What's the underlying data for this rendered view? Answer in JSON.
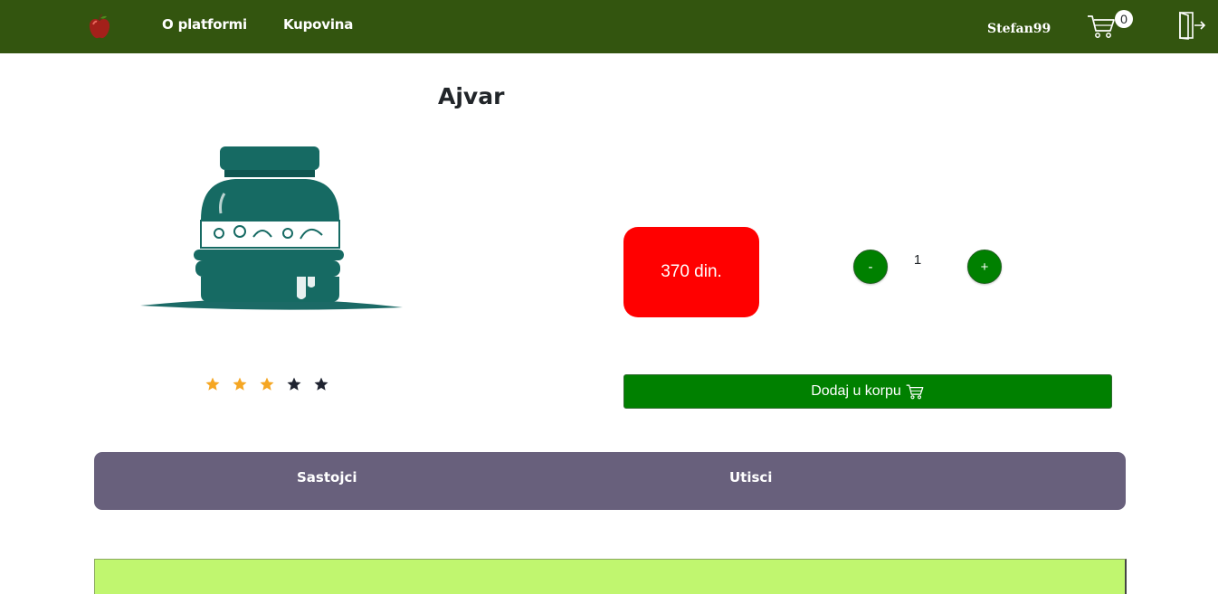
{
  "navbar": {
    "logo_icon": "apple-logo-icon",
    "links": {
      "about": "O platformi",
      "shop": "Kupovina"
    },
    "username": "Stefan99",
    "cart_icon": "shopping-cart-icon",
    "cart_count": "0",
    "logout_icon": "logout-door-icon",
    "background": "#33550f"
  },
  "product": {
    "title": "Ajvar",
    "image": "ajvar-jar-illustration",
    "rating": {
      "value": 3,
      "max": 5,
      "filled_color": "#f5a623",
      "empty_color": "#1f2330"
    },
    "price": "370 din.",
    "quantity": {
      "minus_label": "-",
      "value": "1",
      "plus_label": "+"
    },
    "add_to_cart_label": "Dodaj u korpu",
    "add_to_cart_icon": "shopping-cart-icon"
  },
  "tabs": [
    {
      "label": "Sastojci"
    },
    {
      "label": "Utisci"
    }
  ],
  "colors": {
    "price_bg": "#ff0000",
    "button_green": "#008000",
    "tabs_bg": "#68607c",
    "panel_bg": "#c0f66f"
  }
}
